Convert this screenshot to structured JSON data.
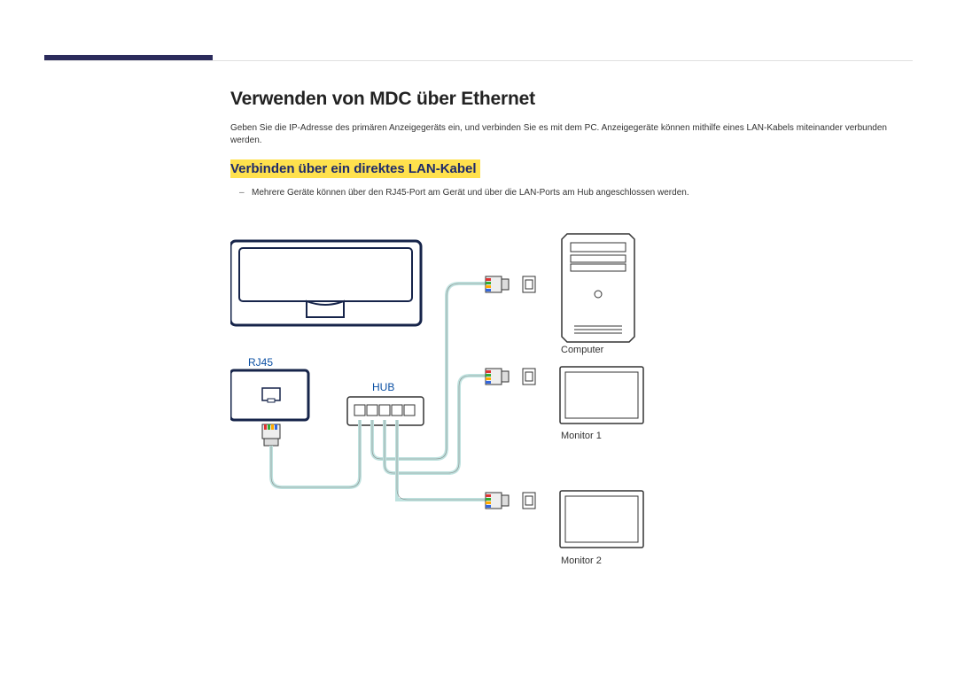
{
  "title": "Verwenden von MDC über Ethernet",
  "paragraph": "Geben Sie die IP-Adresse des primären Anzeigegeräts ein, und verbinden Sie es mit dem PC. Anzeigegeräte können mithilfe eines LAN-Kabels miteinander verbunden werden.",
  "subtitle": "Verbinden über ein direktes LAN-Kabel",
  "bullet1": "Mehrere Geräte können über den RJ45-Port am Gerät und über die LAN-Ports am Hub angeschlossen werden.",
  "labels": {
    "rj45": "RJ45",
    "hub": "HUB",
    "computer": "Computer",
    "monitor1": "Monitor 1",
    "monitor2": "Monitor 2"
  }
}
